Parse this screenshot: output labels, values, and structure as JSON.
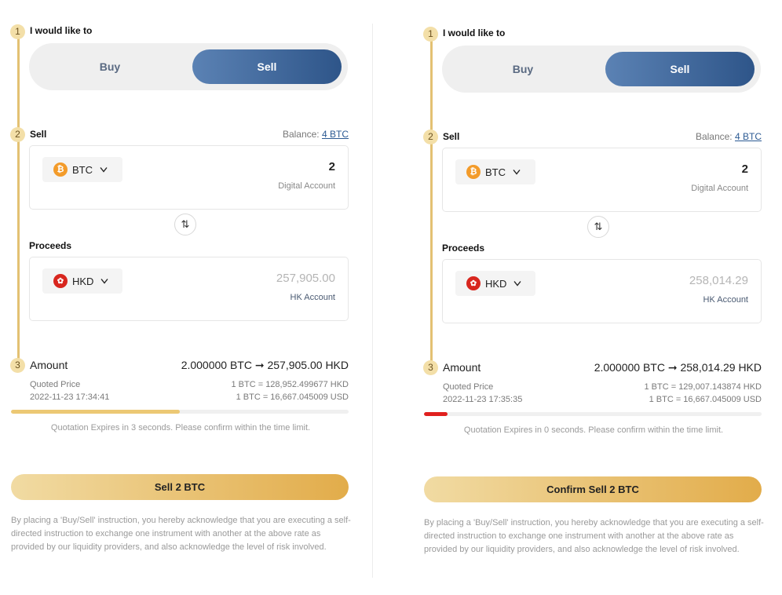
{
  "panels": [
    {
      "step1_label": "I would like to",
      "toggle": {
        "buy": "Buy",
        "sell": "Sell"
      },
      "step2_label": "Sell",
      "balance_label": "Balance:",
      "balance_value": "4 BTC",
      "sell_currency": "BTC",
      "sell_amount": "2",
      "sell_account": "Digital Account",
      "swap_icon": "⇅",
      "proceeds_label": "Proceeds",
      "proceeds_currency": "HKD",
      "proceeds_amount": "257,905.00",
      "proceeds_account": "HK Account",
      "step3_label": "Amount",
      "amount_summary": "2.000000 BTC ➞ 257,905.00 HKD",
      "quoted_price_label": "Quoted Price",
      "quote_time": "2022-11-23 17:34:41",
      "rate_hkd": "1 BTC = 128,952.499677 HKD",
      "rate_usd": "1 BTC = 16,667.045009 USD",
      "progress_fraction": 0.5,
      "progress_color": "#ecc874",
      "expire_text": "Quotation Expires in 3 seconds. Please confirm within the time limit.",
      "confirm_label": "Sell 2 BTC",
      "disclaimer": "By placing a 'Buy/Sell' instruction, you hereby acknowledge that you are executing a self-directed instruction to exchange one instrument with another at the above rate as provided by our liquidity providers, and also acknowledge the level of risk involved."
    },
    {
      "step1_label": "I would like to",
      "toggle": {
        "buy": "Buy",
        "sell": "Sell"
      },
      "step2_label": "Sell",
      "balance_label": "Balance:",
      "balance_value": "4 BTC",
      "sell_currency": "BTC",
      "sell_amount": "2",
      "sell_account": "Digital Account",
      "swap_icon": "⇅",
      "proceeds_label": "Proceeds",
      "proceeds_currency": "HKD",
      "proceeds_amount": "258,014.29",
      "proceeds_account": "HK Account",
      "step3_label": "Amount",
      "amount_summary": "2.000000 BTC ➞ 258,014.29 HKD",
      "quoted_price_label": "Quoted Price",
      "quote_time": "2022-11-23 17:35:35",
      "rate_hkd": "1 BTC = 129,007.143874 HKD",
      "rate_usd": "1 BTC = 16,667.045009 USD",
      "progress_fraction": 0.07,
      "progress_color": "#e0201e",
      "expire_text": "Quotation Expires in 0 seconds. Please confirm within the time limit.",
      "confirm_label": "Confirm Sell 2 BTC",
      "disclaimer": "By placing a 'Buy/Sell' instruction, you hereby acknowledge that you are executing a self-directed instruction to exchange one instrument with another at the above rate as provided by our liquidity providers, and also acknowledge the level of risk involved."
    }
  ],
  "step_numbers": [
    "1",
    "2",
    "3"
  ]
}
